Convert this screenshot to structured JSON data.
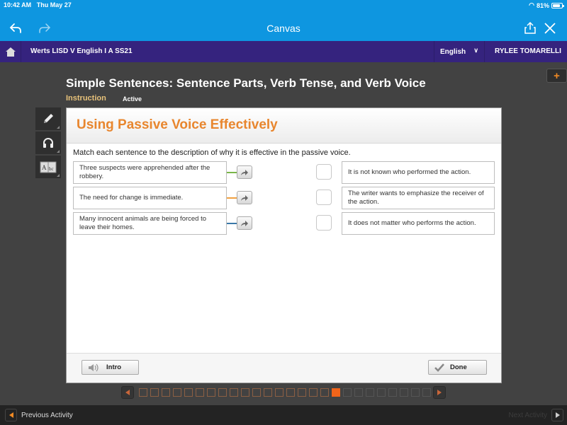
{
  "status_bar": {
    "time": "10:42 AM",
    "date": "Thu May 27",
    "battery": "81%"
  },
  "browser": {
    "title": "Canvas"
  },
  "course_bar": {
    "course": "Werts LISD V English I A SS21",
    "language": "English",
    "user": "RYLEE TOMARELLI"
  },
  "lesson": {
    "title": "Simple Sentences: Sentence Parts, Verb Tense, and Verb Voice",
    "mode": "Instruction",
    "status": "Active"
  },
  "panel": {
    "title": "Using Passive Voice Effectively",
    "instructions": "Match each sentence to the description of why it is effective in the passive voice.",
    "sentences": [
      {
        "text": "Three suspects were apprehended after the robbery.",
        "color": "#7ab648"
      },
      {
        "text": "The need for change is immediate.",
        "color": "#f0a040"
      },
      {
        "text": "Many innocent animals are being forced to leave their homes.",
        "color": "#3a78a8"
      }
    ],
    "descriptions": [
      {
        "text": "It is not known who performed the action."
      },
      {
        "text": "The writer wants to emphasize the receiver of the action."
      },
      {
        "text": "It does not matter who performs the action."
      }
    ],
    "intro_label": "Intro",
    "done_label": "Done"
  },
  "progress": {
    "total": 26,
    "current": 18
  },
  "footer": {
    "previous": "Previous Activity",
    "next": "Next Activity"
  }
}
